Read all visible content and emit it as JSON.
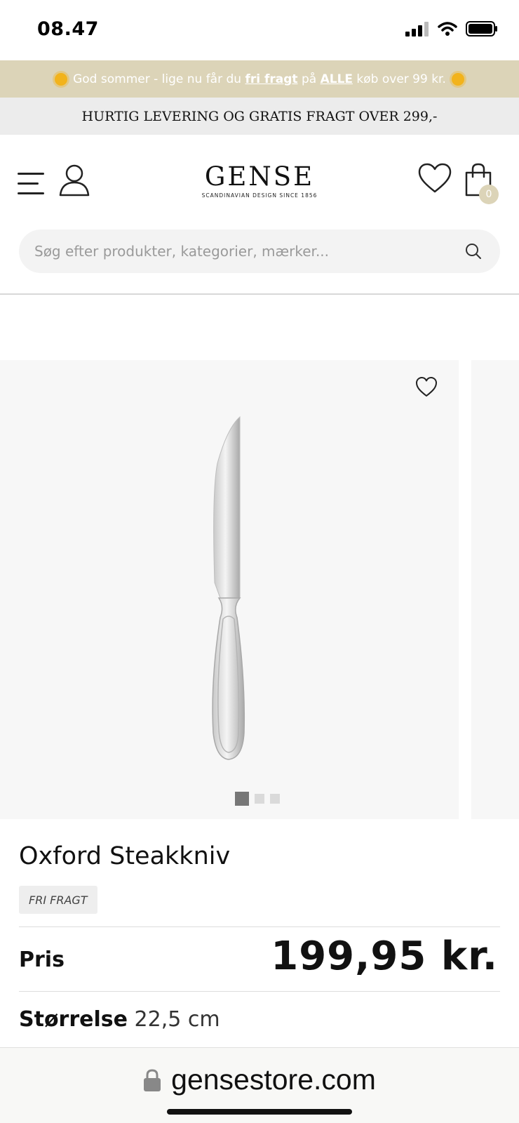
{
  "status_bar": {
    "time": "08.47"
  },
  "promo": {
    "text_before": "God sommer - lige nu får du ",
    "link1": "fri fragt",
    "text_mid": " på ",
    "link2": "ALLE",
    "text_after": " køb over 99 kr."
  },
  "delivery_banner": "HURTIG LEVERING OG GRATIS FRAGT OVER 299,-",
  "header": {
    "logo_word": "GENSE",
    "logo_tagline": "SCANDINAVIAN DESIGN SINCE 1856",
    "cart_count": "0"
  },
  "search": {
    "placeholder": "Søg efter produkter, kategorier, mærker..."
  },
  "product": {
    "title": "Oxford Steakkniv",
    "badge": "FRI FRAGT",
    "price_label": "Pris",
    "price": "199,95 kr.",
    "size_label": "Størrelse",
    "size_value": "22,5 cm",
    "image_count": 3,
    "active_image": 1
  },
  "browser": {
    "url": "gensestore.com"
  },
  "colors": {
    "accent": "#dcd4b8",
    "banner_grey": "#ececec",
    "image_bg": "#f7f7f7"
  },
  "icons": [
    "signal-icon",
    "wifi-icon",
    "battery-icon",
    "sun-icon",
    "menu-icon",
    "user-icon",
    "heart-icon",
    "bag-icon",
    "search-icon",
    "wishlist-heart-icon",
    "lock-icon"
  ]
}
